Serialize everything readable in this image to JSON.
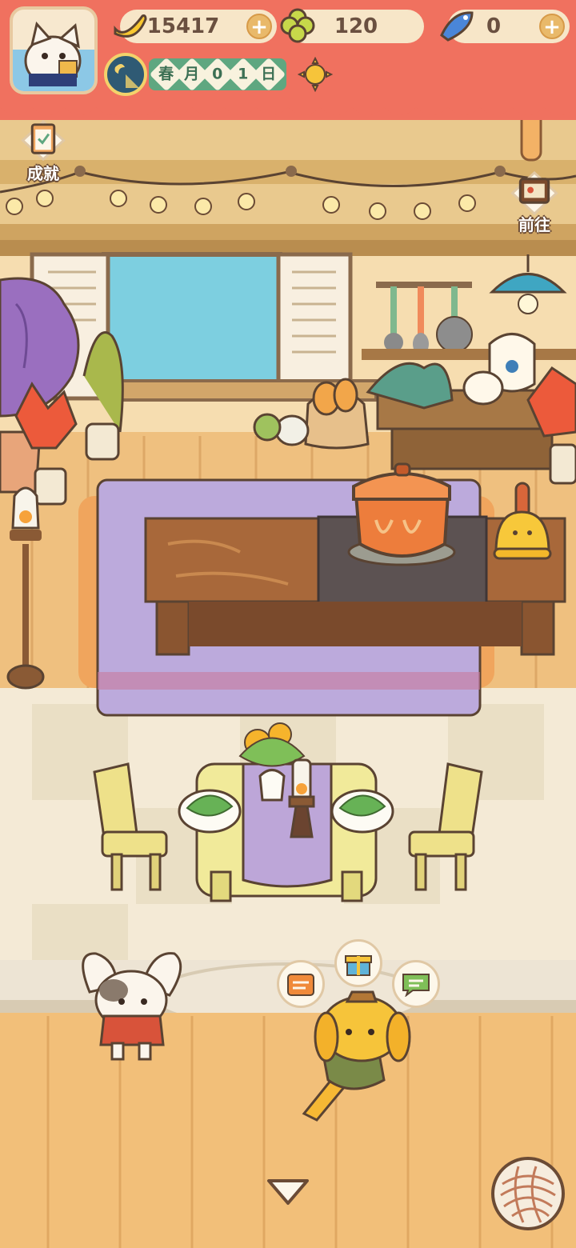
{
  "resources": {
    "bananas": {
      "value": "15417",
      "icon": "banana-icon"
    },
    "clovers": {
      "value": "120",
      "icon": "clover-icon"
    },
    "fish": {
      "value": "0",
      "icon": "fish-icon"
    }
  },
  "date": {
    "chars": [
      "春",
      "月",
      "0",
      "1",
      "日"
    ]
  },
  "weather": {
    "icon": "sun-icon"
  },
  "side_buttons": {
    "achievements": "成就",
    "goto": "前往"
  },
  "colors": {
    "hud": "#f0715f",
    "wall": "#f4d9a8",
    "floor_wood": "#f0c582",
    "rug": "#b9a4d8",
    "tile": "#f3e8d3"
  }
}
